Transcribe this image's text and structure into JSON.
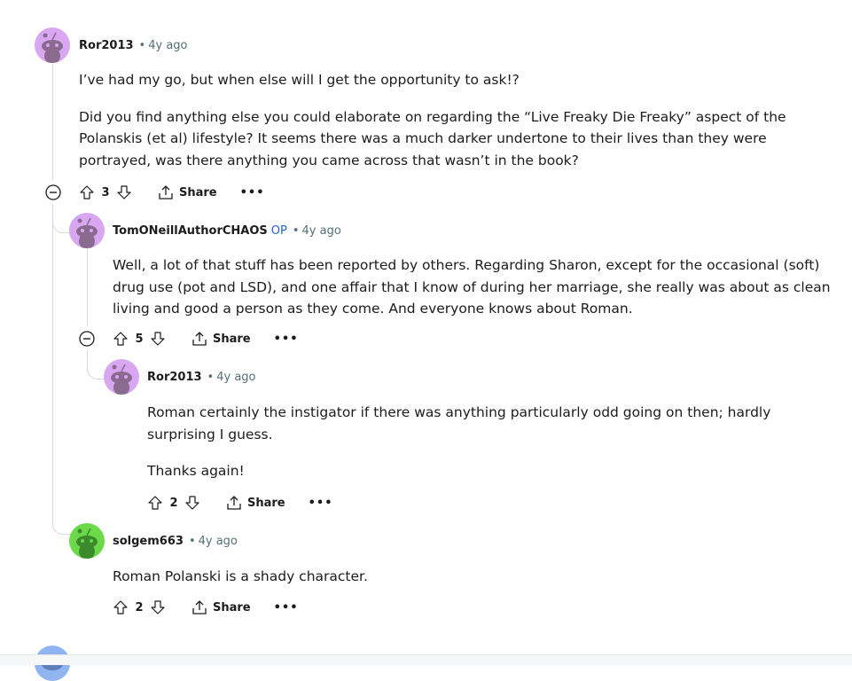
{
  "comments": [
    {
      "author": "Ror2013",
      "op_badge": "",
      "time": "4y ago",
      "paragraphs": [
        "I’ve had my go, but when else will I get the opportunity to ask!?",
        "Did you find anything else you could elaborate on regarding the “Live Freaky Die Freaky” aspect of the Polanskis (et al) lifestyle? It seems there was a much darker undertone to their lives than they were portrayed, was there anything you came across that wasn’t in the book?"
      ],
      "score": "3",
      "share_label": "Share",
      "more_label": "•••",
      "avatar_color": "#d9a6f1"
    },
    {
      "author": "TomONeillAuthorCHAOS",
      "op_badge": "OP",
      "time": "4y ago",
      "paragraphs": [
        "Well, a lot of that stuff has been reported by others. Regarding Sharon, except for the occasional (soft) drug use (pot and LSD), and one affair that I know of during her marriage, she really was about as clean living and good a person as they come. And everyone knows about Roman."
      ],
      "score": "5",
      "share_label": "Share",
      "more_label": "•••",
      "avatar_color": "#d9a6f1"
    },
    {
      "author": "Ror2013",
      "op_badge": "",
      "time": "4y ago",
      "paragraphs": [
        "Roman certainly the instigator if there was anything particularly odd going on then; hardly surprising I guess.",
        "Thanks again!"
      ],
      "score": "2",
      "share_label": "Share",
      "more_label": "•••",
      "avatar_color": "#d9a6f1"
    },
    {
      "author": "solgem663",
      "op_badge": "",
      "time": "4y ago",
      "paragraphs": [
        "Roman Polanski is a shady character."
      ],
      "score": "2",
      "share_label": "Share",
      "more_label": "•••",
      "avatar_color": "#6bd94a"
    }
  ],
  "next_avatar_color": "#8fb4f0"
}
